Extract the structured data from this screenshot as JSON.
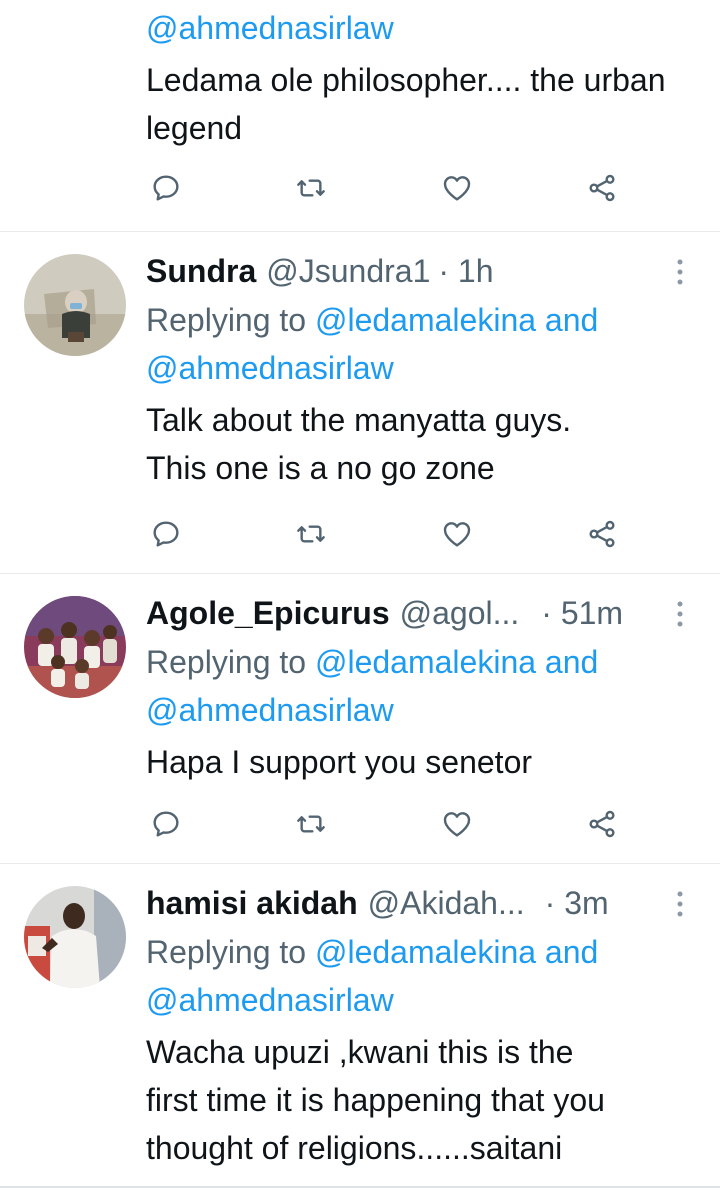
{
  "tweets": [
    {
      "partial": true,
      "reply_to_2": "@ahmednasirlaw",
      "text": "Ledama ole philosopher.... the urban legend"
    },
    {
      "display_name": "Sundra",
      "handle": "@Jsundra1",
      "time": "· 1h",
      "replying_prefix": "Replying to",
      "reply_to_1": "@ledamalekina",
      "reply_and": "and",
      "reply_to_2": "@ahmednasirlaw",
      "text_line1": "Talk about the manyatta guys.",
      "text_line2": "This one is a no go zone"
    },
    {
      "display_name": "Agole_Epicurus",
      "handle": "@agol...",
      "time": "· 51m",
      "replying_prefix": "Replying to",
      "reply_to_1": "@ledamalekina",
      "reply_and": "and",
      "reply_to_2": "@ahmednasirlaw",
      "text_line1": "Hapa I support you senetor"
    },
    {
      "display_name": "hamisi akidah",
      "handle": "@Akidah...",
      "time": "· 3m",
      "replying_prefix": "Replying to",
      "reply_to_1": "@ledamalekina",
      "reply_and": "and",
      "reply_to_2": "@ahmednasirlaw",
      "text_line1": "Wacha upuzi ,kwani this is the",
      "text_line2": "first time it is happening that you",
      "text_line3": "thought of religions......saitani"
    }
  ],
  "icons": {
    "reply": "reply-icon",
    "retweet": "retweet-icon",
    "like": "heart-icon",
    "share": "share-icon",
    "more": "more-vertical-icon"
  },
  "colors": {
    "text": "#0f1419",
    "secondary": "#536471",
    "link": "#1d9bf0",
    "divider": "#e7e9eb"
  }
}
